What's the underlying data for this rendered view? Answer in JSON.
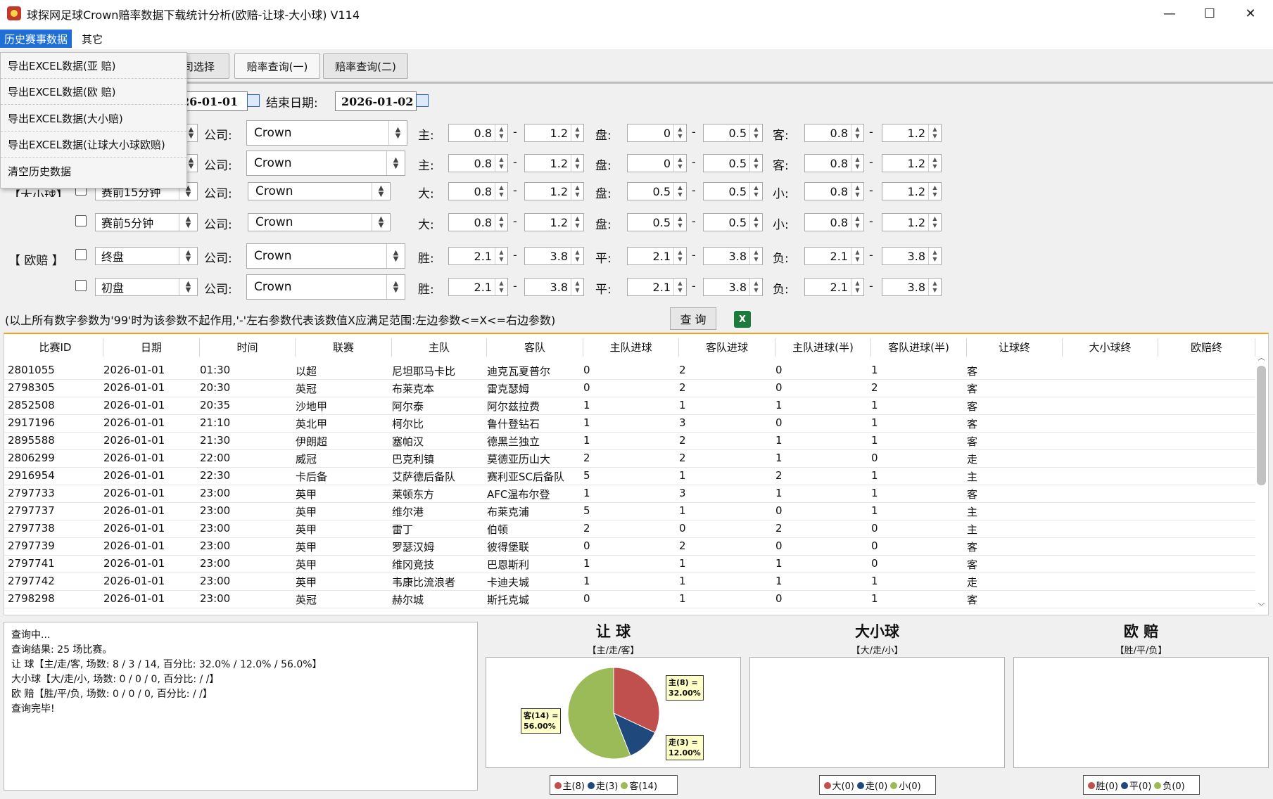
{
  "window": {
    "title": "球探网足球Crown赔率数据下载统计分析(欧赔-让球-大小球) V114",
    "min": "—",
    "max": "☐",
    "close": "✕"
  },
  "menu": {
    "history": "历史赛事数据",
    "other": "其它"
  },
  "dropdown": [
    "导出EXCEL数据(亚  赔)",
    "导出EXCEL数据(欧  赔)",
    "导出EXCEL数据(大小赔)",
    "导出EXCEL数据(让球大小球欧赔)",
    "清空历史数据"
  ],
  "tabs": {
    "company": "司选择",
    "odds1": "赔率查询(一)",
    "odds2": "赔率查询(二)"
  },
  "dates": {
    "start_value": "26-01-01",
    "end_label": "结束日期:",
    "end_value": "2026-01-02"
  },
  "labels": {
    "company": "公司:",
    "daxiao": "【大小球】",
    "oupei": "【  欧赔  】"
  },
  "form_rows": [
    {
      "checkbox": false,
      "period": "",
      "company": "Crown",
      "k1": "主:",
      "a1": "0.8",
      "a2": "1.2",
      "k2": "盘:",
      "b1": "0",
      "b2": "0.5",
      "k3": "客:",
      "c1": "0.8",
      "c2": "1.2"
    },
    {
      "checkbox": false,
      "period": "",
      "company": "Crown",
      "k1": "主:",
      "a1": "0.8",
      "a2": "1.2",
      "k2": "盘:",
      "b1": "0",
      "b2": "0.5",
      "k3": "客:",
      "c1": "0.8",
      "c2": "1.2"
    },
    {
      "checkbox": false,
      "period": "赛前15分钟",
      "company": "Crown",
      "k1": "大:",
      "a1": "0.8",
      "a2": "1.2",
      "k2": "盘:",
      "b1": "0.5",
      "b2": "0.5",
      "k3": "小:",
      "c1": "0.8",
      "c2": "1.2"
    },
    {
      "checkbox": false,
      "period": "赛前5分钟",
      "company": "Crown",
      "k1": "大:",
      "a1": "0.8",
      "a2": "1.2",
      "k2": "盘:",
      "b1": "0.5",
      "b2": "0.5",
      "k3": "小:",
      "c1": "0.8",
      "c2": "1.2"
    },
    {
      "checkbox": false,
      "period": "终盘",
      "company": "Crown",
      "k1": "胜:",
      "a1": "2.1",
      "a2": "3.8",
      "k2": "平:",
      "b1": "2.1",
      "b2": "3.8",
      "k3": "负:",
      "c1": "2.1",
      "c2": "3.8"
    },
    {
      "checkbox": false,
      "period": "初盘",
      "company": "Crown",
      "k1": "胜:",
      "a1": "2.1",
      "a2": "3.8",
      "k2": "平:",
      "b1": "2.1",
      "b2": "3.8",
      "k3": "负:",
      "c1": "2.1",
      "c2": "3.8"
    }
  ],
  "note": "(以上所有数字参数为'99'时为该参数不起作用,'-'左右参数代表该数值X应满足范围:左边参数<=X<=右边参数)",
  "query_button": "查 询",
  "excel_icon_label": "X",
  "table": {
    "columns": [
      "比赛ID",
      "日期",
      "时间",
      "联赛",
      "主队",
      "客队",
      "主队进球",
      "客队进球",
      "主队进球(半)",
      "客队进球(半)",
      "让球终",
      "大小球终",
      "欧赔终"
    ],
    "rows": [
      [
        "2801055",
        "2026-01-01",
        "01:30",
        "以超",
        "尼坦耶马卡比",
        "迪克瓦夏普尔",
        "0",
        "2",
        "0",
        "1",
        "客"
      ],
      [
        "2798305",
        "2026-01-01",
        "20:30",
        "英冠",
        "布莱克本",
        "雷克瑟姆",
        "0",
        "2",
        "0",
        "2",
        "客"
      ],
      [
        "2852508",
        "2026-01-01",
        "20:35",
        "沙地甲",
        "阿尔泰",
        "阿尔兹拉费",
        "1",
        "1",
        "1",
        "1",
        "客"
      ],
      [
        "2917196",
        "2026-01-01",
        "21:10",
        "英北甲",
        "柯尔比",
        "鲁什登钻石",
        "1",
        "3",
        "0",
        "1",
        "客"
      ],
      [
        "2895588",
        "2026-01-01",
        "21:30",
        "伊朗超",
        "塞帕汉",
        "德黑兰独立",
        "1",
        "2",
        "1",
        "1",
        "客"
      ],
      [
        "2806299",
        "2026-01-01",
        "22:00",
        "威冠",
        "巴克利镇",
        "莫德亚历山大",
        "2",
        "2",
        "1",
        "0",
        "走"
      ],
      [
        "2916954",
        "2026-01-01",
        "22:30",
        "卡后备",
        "艾萨德后备队",
        "赛利亚SC后备队",
        "5",
        "1",
        "2",
        "1",
        "主"
      ],
      [
        "2797733",
        "2026-01-01",
        "23:00",
        "英甲",
        "莱顿东方",
        "AFC温布尔登",
        "1",
        "3",
        "1",
        "1",
        "客"
      ],
      [
        "2797737",
        "2026-01-01",
        "23:00",
        "英甲",
        "维尔港",
        "布莱克浦",
        "5",
        "1",
        "0",
        "1",
        "主"
      ],
      [
        "2797738",
        "2026-01-01",
        "23:00",
        "英甲",
        "雷丁",
        "伯顿",
        "2",
        "0",
        "2",
        "0",
        "主"
      ],
      [
        "2797739",
        "2026-01-01",
        "23:00",
        "英甲",
        "罗瑟汉姆",
        "彼得堡联",
        "0",
        "2",
        "0",
        "0",
        "客"
      ],
      [
        "2797741",
        "2026-01-01",
        "23:00",
        "英甲",
        "维冈竞技",
        "巴恩斯利",
        "1",
        "1",
        "1",
        "0",
        "客"
      ],
      [
        "2797742",
        "2026-01-01",
        "23:00",
        "英甲",
        "韦康比流浪者",
        "卡迪夫城",
        "1",
        "1",
        "1",
        "1",
        "走"
      ],
      [
        "2798298",
        "2026-01-01",
        "23:00",
        "英冠",
        "赫尔城",
        "斯托克城",
        "0",
        "1",
        "0",
        "1",
        "客"
      ]
    ]
  },
  "log": [
    "查询中...",
    "查询结果:  25 场比赛。",
    "让 球【主/走/客,  场数: 8 / 3 / 14,   百分比: 32.0% / 12.0% / 56.0%】",
    "大小球【大/走/小,  场数: 0 / 0 / 0,   百分比:  /  /】",
    "欧 赔【胜/平/负,  场数: 0 / 0 / 0,   百分比:  /  /】",
    "查询完毕!"
  ],
  "colors": {
    "red": "#c0504d",
    "blue": "#1f497d",
    "green": "#9bbb59",
    "menu_active": "#1e6fd6",
    "table_border": "#f0a020"
  },
  "chart_data": [
    {
      "type": "pie",
      "title": "让  球",
      "subtitle": "【主/走/客】",
      "categories": [
        "主",
        "走",
        "客"
      ],
      "values": [
        8,
        3,
        14
      ],
      "percent_labels": [
        "32.00%",
        "12.00%",
        "56.00%"
      ],
      "callouts": [
        "主(8) =",
        "走(3) =",
        "客(14) ="
      ],
      "legend": [
        "主(8)",
        "走(3)",
        "客(14)"
      ]
    },
    {
      "type": "pie",
      "title": "大小球",
      "subtitle": "【大/走/小】",
      "categories": [
        "大",
        "走",
        "小"
      ],
      "values": [
        0,
        0,
        0
      ],
      "legend": [
        "大(0)",
        "走(0)",
        "小(0)"
      ]
    },
    {
      "type": "pie",
      "title": "欧  赔",
      "subtitle": "【胜/平/负】",
      "categories": [
        "胜",
        "平",
        "负"
      ],
      "values": [
        0,
        0,
        0
      ],
      "legend": [
        "胜(0)",
        "平(0)",
        "负(0)"
      ]
    }
  ]
}
